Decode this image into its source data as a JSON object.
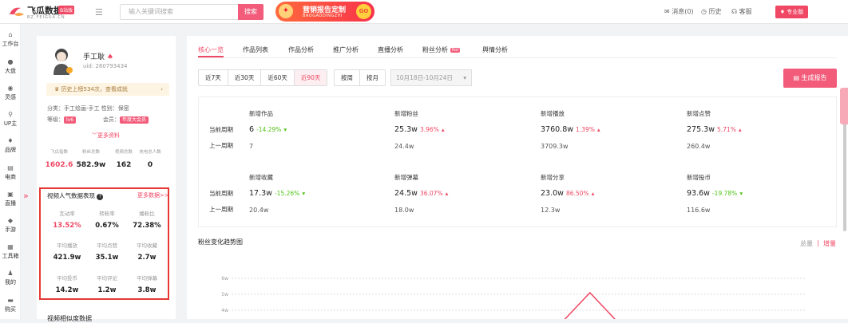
{
  "header": {
    "logo_text": "飞瓜数据",
    "logo_tag": "B站版",
    "logo_sub": "BZ.FEIGUA.CN",
    "search_placeholder": "输入关键词搜索",
    "search_button": "搜索",
    "banner_title": "营销报告定制",
    "banner_sub": "BAOGAODINGZHI",
    "banner_go": "GO",
    "links": [
      "消息(0)",
      "历史",
      "客服"
    ],
    "vip_label": "专业版"
  },
  "sidenav": {
    "items": [
      "工作台",
      "大盘",
      "灵感",
      "UP主",
      "品牌",
      "电商",
      "直播",
      "手游",
      "工具箱",
      "我的",
      "购买"
    ]
  },
  "profile": {
    "name": "手工耿",
    "uid": "uid: 280793434",
    "history": "历史上榜534次，查看成就",
    "category": "分类：手工绘画-手工",
    "gender": "性别：",
    "gender_value": "保密",
    "level_label": "等级：",
    "level": "lv6",
    "member_label": "会员：",
    "member": "年度大会员",
    "more": "更多资料",
    "stats": [
      {
        "label": "飞瓜指数",
        "value": "1602.6",
        "color": "#f04864"
      },
      {
        "label": "粉丝总数",
        "value": "582.9w",
        "color": "#222"
      },
      {
        "label": "视频总数",
        "value": "162",
        "color": "#222"
      },
      {
        "label": "充电总人数",
        "value": "0",
        "color": "#222"
      }
    ]
  },
  "performance": {
    "title": "视频人气数据表现",
    "more": "更多数据>>",
    "metrics": [
      {
        "label": "互动率",
        "value": "13.52%",
        "color": "#f04864"
      },
      {
        "label": "转粉率",
        "value": "0.67%",
        "color": "#222"
      },
      {
        "label": "播粉比",
        "value": "72.38%",
        "color": "#222"
      },
      {
        "label": "平均播放",
        "value": "421.9w",
        "color": "#222"
      },
      {
        "label": "平均点赞",
        "value": "35.1w",
        "color": "#222"
      },
      {
        "label": "平均收藏",
        "value": "2.7w",
        "color": "#222"
      },
      {
        "label": "平均投币",
        "value": "14.2w",
        "color": "#222"
      },
      {
        "label": "平均评论",
        "value": "1.2w",
        "color": "#222"
      },
      {
        "label": "平均弹幕",
        "value": "3.8w",
        "color": "#222"
      }
    ],
    "next_section": "视频相似度数据"
  },
  "tabs": [
    {
      "label": "核心一览",
      "active": true
    },
    {
      "label": "作品列表",
      "active": false
    },
    {
      "label": "作品分析",
      "active": false
    },
    {
      "label": "推广分析",
      "active": false
    },
    {
      "label": "直播分析",
      "active": false
    },
    {
      "label": "粉丝分析",
      "active": false,
      "hot": "Hot"
    },
    {
      "label": "舆情分析",
      "active": false
    }
  ],
  "filters": {
    "ranges": [
      "近7天",
      "近30天",
      "近60天",
      "近90天"
    ],
    "selected_range": "近90天",
    "units": [
      "按周",
      "按月"
    ],
    "date_range": "10月18日-10月24日",
    "generate": "生成报告"
  },
  "core": {
    "current_label": "当前周期",
    "prev_label": "上一周期",
    "metrics": [
      {
        "title": "新增作品",
        "value": "6",
        "change": "-14.29%",
        "dir": "dn",
        "prev": "7"
      },
      {
        "title": "新增粉丝",
        "value": "25.3w",
        "change": "3.96%",
        "dir": "up",
        "prev": "24.4w"
      },
      {
        "title": "新增播放",
        "value": "3760.8w",
        "change": "1.39%",
        "dir": "up",
        "prev": "3709.3w"
      },
      {
        "title": "新增点赞",
        "value": "275.3w",
        "change": "5.71%",
        "dir": "up",
        "prev": "260.4w"
      },
      {
        "title": "新增收藏",
        "value": "17.3w",
        "change": "-15.26%",
        "dir": "dn",
        "prev": "20.4w"
      },
      {
        "title": "新增弹幕",
        "value": "24.5w",
        "change": "36.07%",
        "dir": "up",
        "prev": "18.0w"
      },
      {
        "title": "新增分享",
        "value": "23.0w",
        "change": "86.50%",
        "dir": "up",
        "prev": "12.3w"
      },
      {
        "title": "新增投币",
        "value": "93.6w",
        "change": "-19.78%",
        "dir": "dn",
        "prev": "116.6w"
      }
    ]
  },
  "trend": {
    "title": "粉丝变化趋势图",
    "total": "总量",
    "sep": "|",
    "increment": "增量"
  },
  "chart_data": {
    "type": "line",
    "title": "粉丝变化趋势图",
    "ytick_labels": [
      "6w",
      "5w",
      "4w"
    ],
    "ylim": [
      4,
      6
    ],
    "grid": true,
    "series": [
      {
        "values": [
          4,
          4,
          4,
          4,
          4,
          4,
          4,
          4,
          4,
          4,
          4,
          4,
          5.1,
          4,
          4,
          4,
          4,
          4,
          4,
          4
        ]
      }
    ],
    "color": "#f04864"
  }
}
